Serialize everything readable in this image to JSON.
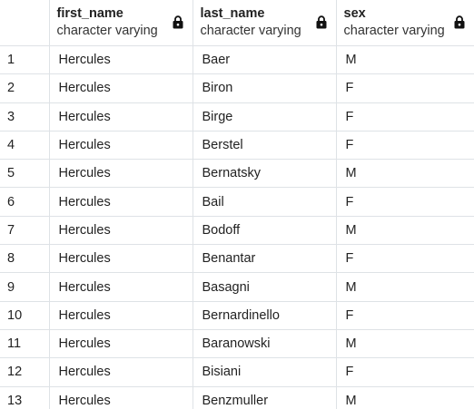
{
  "columns": [
    {
      "name": "first_name",
      "type": "character varying",
      "locked": true
    },
    {
      "name": "last_name",
      "type": "character varying",
      "locked": true
    },
    {
      "name": "sex",
      "type": "character varying",
      "locked": true
    }
  ],
  "rows": [
    {
      "index": "1",
      "first_name": "Hercules",
      "last_name": "Baer",
      "sex": "M"
    },
    {
      "index": "2",
      "first_name": "Hercules",
      "last_name": "Biron",
      "sex": "F"
    },
    {
      "index": "3",
      "first_name": "Hercules",
      "last_name": "Birge",
      "sex": "F"
    },
    {
      "index": "4",
      "first_name": "Hercules",
      "last_name": "Berstel",
      "sex": "F"
    },
    {
      "index": "5",
      "first_name": "Hercules",
      "last_name": "Bernatsky",
      "sex": "M"
    },
    {
      "index": "6",
      "first_name": "Hercules",
      "last_name": "Bail",
      "sex": "F"
    },
    {
      "index": "7",
      "first_name": "Hercules",
      "last_name": "Bodoff",
      "sex": "M"
    },
    {
      "index": "8",
      "first_name": "Hercules",
      "last_name": "Benantar",
      "sex": "F"
    },
    {
      "index": "9",
      "first_name": "Hercules",
      "last_name": "Basagni",
      "sex": "M"
    },
    {
      "index": "10",
      "first_name": "Hercules",
      "last_name": "Bernardinello",
      "sex": "F"
    },
    {
      "index": "11",
      "first_name": "Hercules",
      "last_name": "Baranowski",
      "sex": "M"
    },
    {
      "index": "12",
      "first_name": "Hercules",
      "last_name": "Bisiani",
      "sex": "F"
    },
    {
      "index": "13",
      "first_name": "Hercules",
      "last_name": "Benzmuller",
      "sex": "M"
    }
  ]
}
